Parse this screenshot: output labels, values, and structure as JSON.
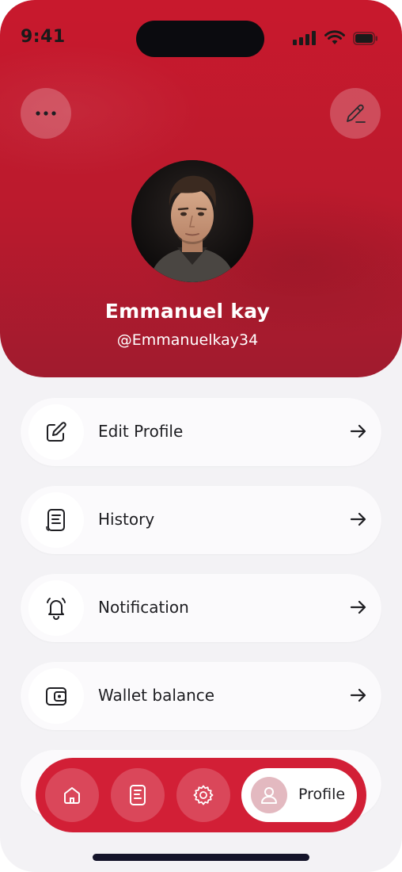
{
  "status_bar": {
    "time": "9:41"
  },
  "profile": {
    "name": "Emmanuel kay",
    "handle": "@Emmanuelkay34"
  },
  "header_buttons": {
    "left_icon": "more-icon",
    "right_icon": "pencil-icon"
  },
  "menu": [
    {
      "label": "Edit Profile",
      "icon": "edit-icon"
    },
    {
      "label": "History",
      "icon": "receipt-icon"
    },
    {
      "label": "Notification",
      "icon": "bell-icon"
    },
    {
      "label": "Wallet balance",
      "icon": "wallet-icon"
    }
  ],
  "bottom_nav": {
    "items": [
      {
        "icon": "home-icon"
      },
      {
        "icon": "receipt-icon"
      },
      {
        "icon": "gear-icon"
      }
    ],
    "active": {
      "label": "Profile",
      "icon": "user-icon"
    }
  },
  "colors": {
    "accent": "#d21f36",
    "header": "#c8192d",
    "background": "#f3f2f5"
  }
}
